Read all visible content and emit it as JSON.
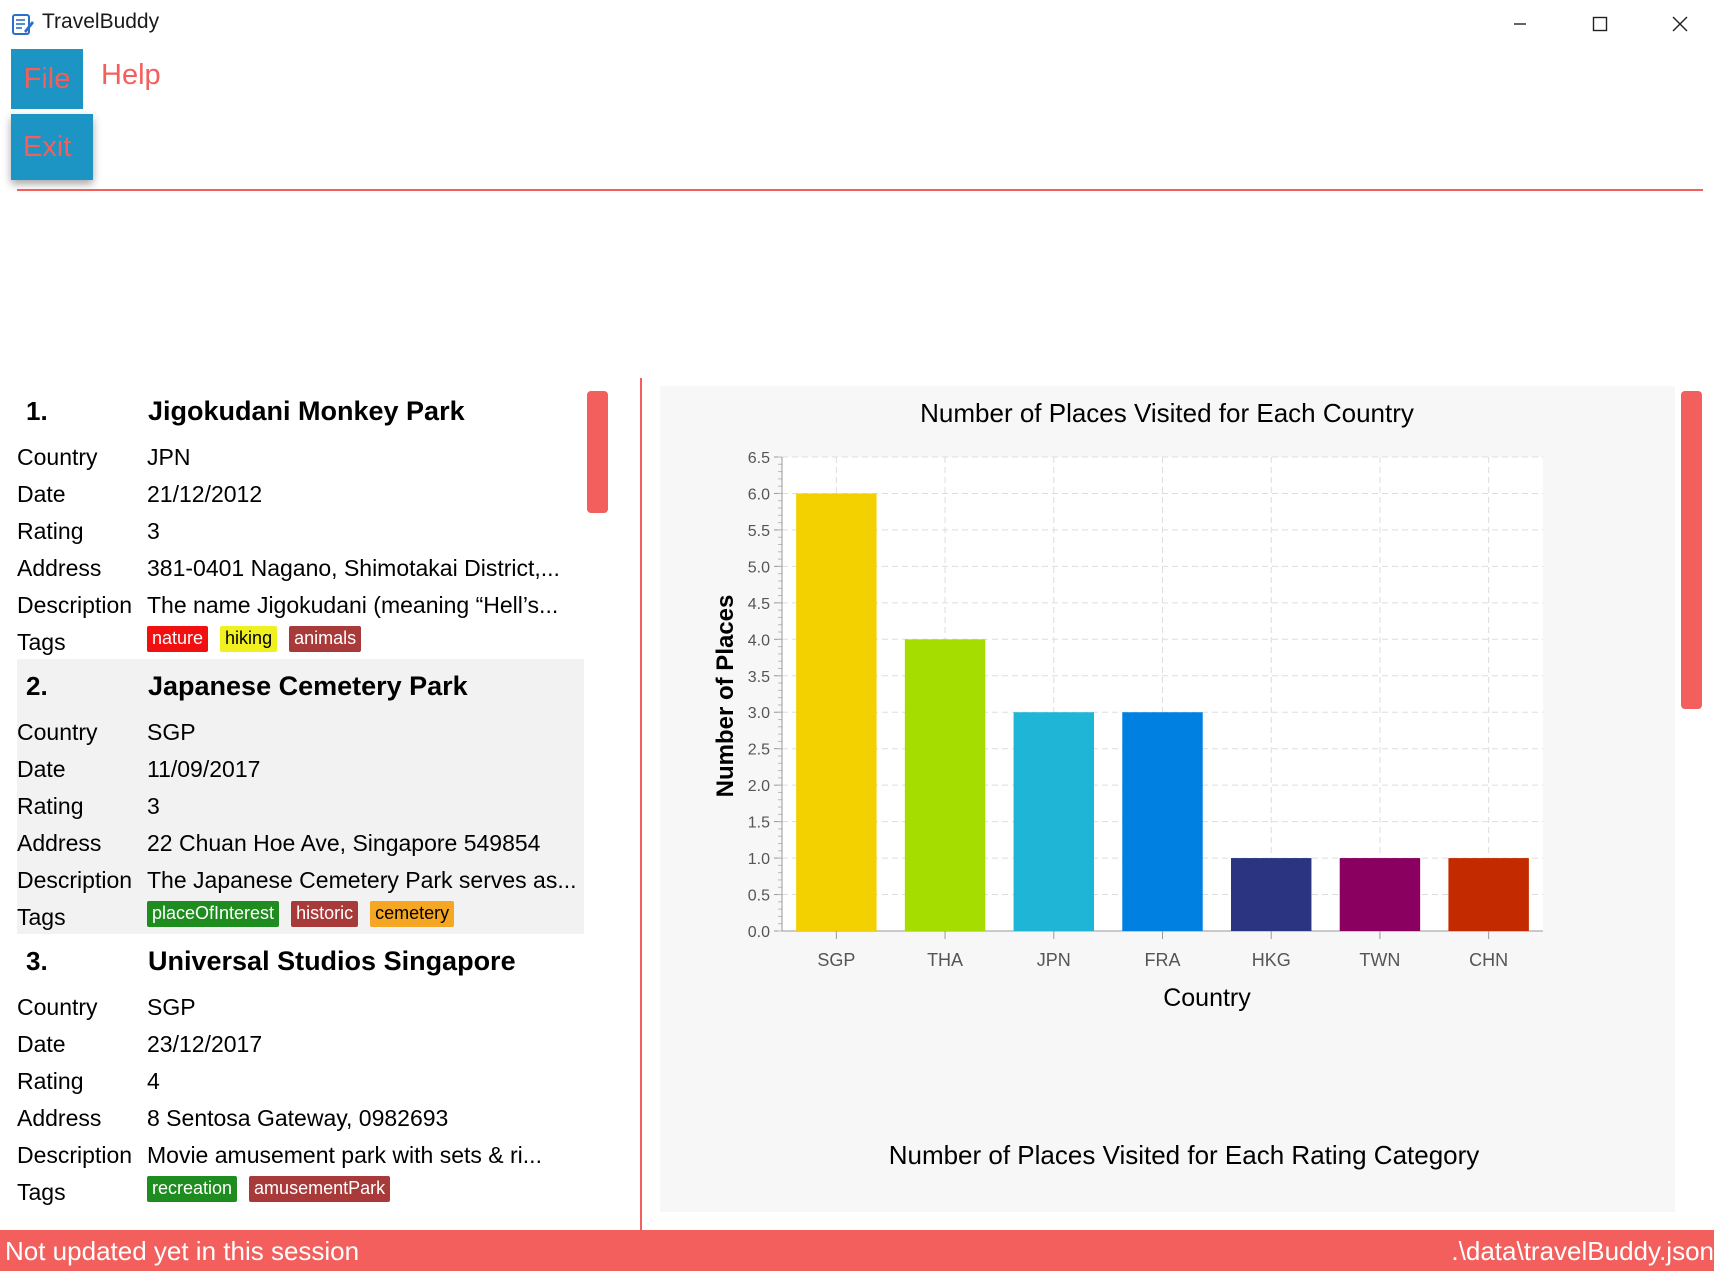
{
  "window": {
    "title": "TravelBuddy"
  },
  "menu": {
    "file": "File",
    "help": "Help",
    "file_items": [
      "Exit"
    ]
  },
  "places": [
    {
      "index": "1.",
      "name": "Jigokudani Monkey Park",
      "fields": [
        {
          "label": "Country",
          "value": "JPN"
        },
        {
          "label": "Date",
          "value": "21/12/2012"
        },
        {
          "label": "Rating",
          "value": "3"
        },
        {
          "label": "Address",
          "value": "381-0401 Nagano, Shimotakai District,..."
        },
        {
          "label": "Description",
          "value": "The name Jigokudani (meaning “Hell’s..."
        }
      ],
      "tags_label": "Tags",
      "tags": [
        {
          "text": "nature",
          "color": "#f20f0f",
          "dark": false
        },
        {
          "text": "hiking",
          "color": "#f0f020",
          "dark": true
        },
        {
          "text": "animals",
          "color": "#a83a3a",
          "dark": false
        }
      ]
    },
    {
      "index": "2.",
      "name": "Japanese Cemetery Park",
      "fields": [
        {
          "label": "Country",
          "value": "SGP"
        },
        {
          "label": "Date",
          "value": "11/09/2017"
        },
        {
          "label": "Rating",
          "value": "3"
        },
        {
          "label": "Address",
          "value": "22 Chuan Hoe Ave, Singapore 549854"
        },
        {
          "label": "Description",
          "value": "The Japanese Cemetery Park serves as..."
        }
      ],
      "tags_label": "Tags",
      "tags": [
        {
          "text": "placeOfInterest",
          "color": "#1e8c1e",
          "dark": false
        },
        {
          "text": "historic",
          "color": "#a83a3a",
          "dark": false
        },
        {
          "text": "cemetery",
          "color": "#f5a623",
          "dark": true
        }
      ]
    },
    {
      "index": "3.",
      "name": "Universal Studios Singapore",
      "fields": [
        {
          "label": "Country",
          "value": "SGP"
        },
        {
          "label": "Date",
          "value": "23/12/2017"
        },
        {
          "label": "Rating",
          "value": "4"
        },
        {
          "label": "Address",
          "value": "8 Sentosa Gateway, 0982693"
        },
        {
          "label": "Description",
          "value": "Movie amusement park with sets & ri..."
        }
      ],
      "tags_label": "Tags",
      "tags": [
        {
          "text": "recreation",
          "color": "#1e8c1e",
          "dark": false
        },
        {
          "text": "amusementPark",
          "color": "#a83a3a",
          "dark": false
        }
      ]
    }
  ],
  "chart_data": {
    "type": "bar",
    "title": "Number of Places Visited for Each Country",
    "xlabel": "Country",
    "ylabel": "Number of Places",
    "categories": [
      "SGP",
      "THA",
      "JPN",
      "FRA",
      "HKG",
      "TWN",
      "CHN"
    ],
    "values": [
      6,
      4,
      3,
      3,
      1,
      1,
      1
    ],
    "colors": [
      "#f3d000",
      "#a6dd00",
      "#1fb5d6",
      "#0080e0",
      "#2b3480",
      "#8a0060",
      "#c32a00"
    ],
    "ylim": [
      0,
      6.5
    ],
    "yticks": [
      "0.0",
      "0.5",
      "1.0",
      "1.5",
      "2.0",
      "2.5",
      "3.0",
      "3.5",
      "4.0",
      "4.5",
      "5.0",
      "5.5",
      "6.0",
      "6.5"
    ],
    "grid": true
  },
  "second_chart": {
    "title": "Number of Places Visited for Each Rating Category"
  },
  "status": {
    "left": "Not updated yet in this session",
    "right": ".\\data\\travelBuddy.json"
  },
  "theme": {
    "accent": "#f25f5c",
    "menu_blue": "#1c94c4"
  }
}
